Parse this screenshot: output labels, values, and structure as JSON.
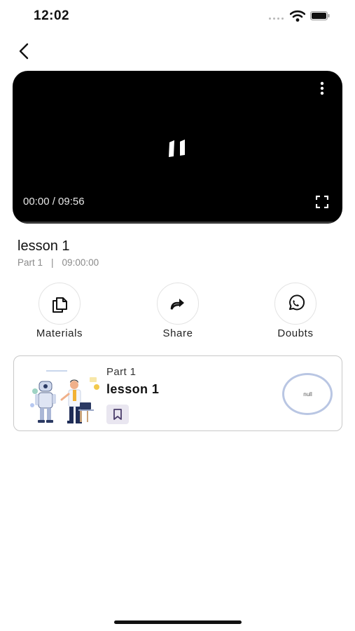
{
  "status_bar": {
    "time": "12:02"
  },
  "video": {
    "time_display": "00:00 / 09:56",
    "progress_fraction": 0.0
  },
  "lesson": {
    "title": "lesson 1",
    "part": "Part 1",
    "separator": "|",
    "duration": "09:00:00"
  },
  "actions": [
    {
      "label": "Materials",
      "icon": "copy-icon"
    },
    {
      "label": "Share",
      "icon": "share-arrow-icon"
    },
    {
      "label": "Doubts",
      "icon": "whatsapp-icon"
    }
  ],
  "lesson_card": {
    "part": "Part 1",
    "title": "lesson 1",
    "progress_text": "null",
    "colors": {
      "ring": "#b9c6e3",
      "bookmark_bg": "#e9e6f0"
    }
  }
}
